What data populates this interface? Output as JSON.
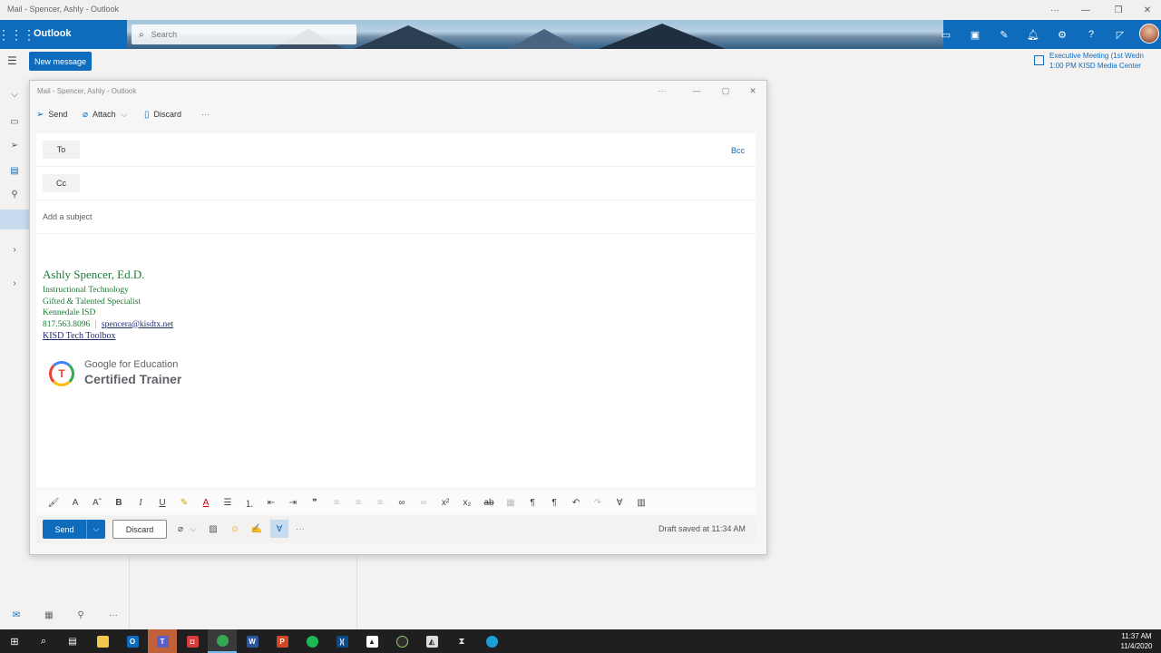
{
  "window": {
    "title": "Mail - Spencer, Ashly - Outlook",
    "more": "···",
    "restore": "❐",
    "minimize": "—",
    "close": "✕"
  },
  "header": {
    "app_name": "Outlook",
    "search_placeholder": "Search"
  },
  "new_message_label": "New message",
  "meeting": {
    "line1": "Executive Meeting (1st Wedn",
    "line2": "1:00 PM KISD Media Center"
  },
  "compose": {
    "title": "Mail - Spencer, Ashly - Outlook",
    "toolbar": {
      "send": "Send",
      "attach": "Attach",
      "discard": "Discard",
      "more": "···"
    },
    "to_label": "To",
    "cc_label": "Cc",
    "bcc_label": "Bcc",
    "subject_placeholder": "Add a subject",
    "signature": {
      "name": "Ashly Spencer, Ed.D.",
      "line1": "Instructional Technology",
      "line2": "Gifted & Talented Specialist",
      "line3": "Kennedale ISD",
      "phone": "817.563.8096",
      "separator": "|",
      "email": "spencera@kisdtx.net",
      "toolbox": "KISD Tech Toolbox",
      "badge_line1": "Google for Education",
      "badge_line2": "Certified Trainer",
      "badge_letter": "T"
    },
    "send_label": "Send",
    "discard_label": "Discard",
    "draft_status": "Draft saved at 11:34 AM",
    "more": "···"
  },
  "taskbar": {
    "time": "11:37 AM",
    "date": "11/4/2020"
  },
  "colors": {
    "brand": "#0f6cbd",
    "signature_green": "#1d7a34"
  }
}
